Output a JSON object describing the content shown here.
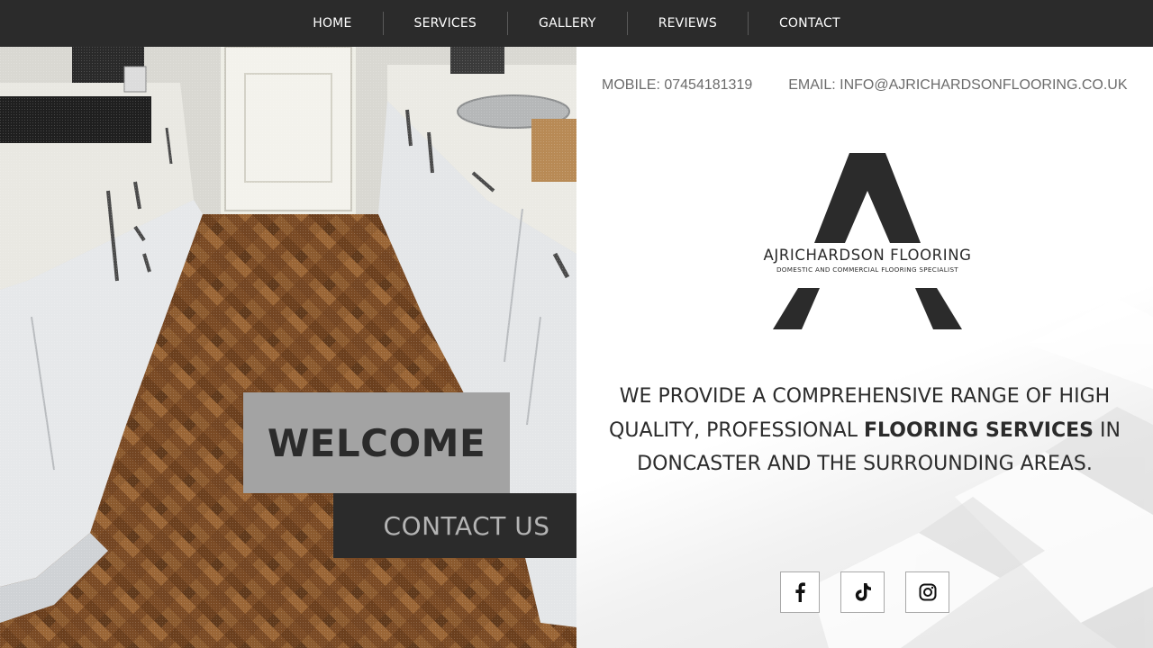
{
  "nav": {
    "items": [
      {
        "label": "HOME"
      },
      {
        "label": "SERVICES"
      },
      {
        "label": "GALLERY"
      },
      {
        "label": "REVIEWS"
      },
      {
        "label": "CONTACT"
      }
    ]
  },
  "hero": {
    "welcome": "WELCOME",
    "cta_label": "CONTACT US"
  },
  "contact": {
    "mobile": "MOBILE: 07454181319",
    "email": "EMAIL: INFO@AJRICHARDSONFLOORING.CO.UK"
  },
  "logo": {
    "name": "AJRICHARDSON FLOORING",
    "tagline": "DOMESTIC AND COMMERCIAL FLOORING SPECIALIST"
  },
  "intro": {
    "before": "WE PROVIDE A COMPREHENSIVE RANGE OF HIGH QUALITY, PROFESSIONAL ",
    "highlight": "FLOORING SERVICES",
    "after": " IN DONCASTER AND THE SURROUNDING AREAS."
  },
  "socials": [
    {
      "icon": "facebook-icon"
    },
    {
      "icon": "tiktok-icon"
    },
    {
      "icon": "instagram-icon"
    }
  ],
  "colors": {
    "dark": "#2b2b2b",
    "welcome_box": "#a3a3a3",
    "cta_text": "#b4b4b4",
    "contact_text": "#6b6b6b"
  }
}
